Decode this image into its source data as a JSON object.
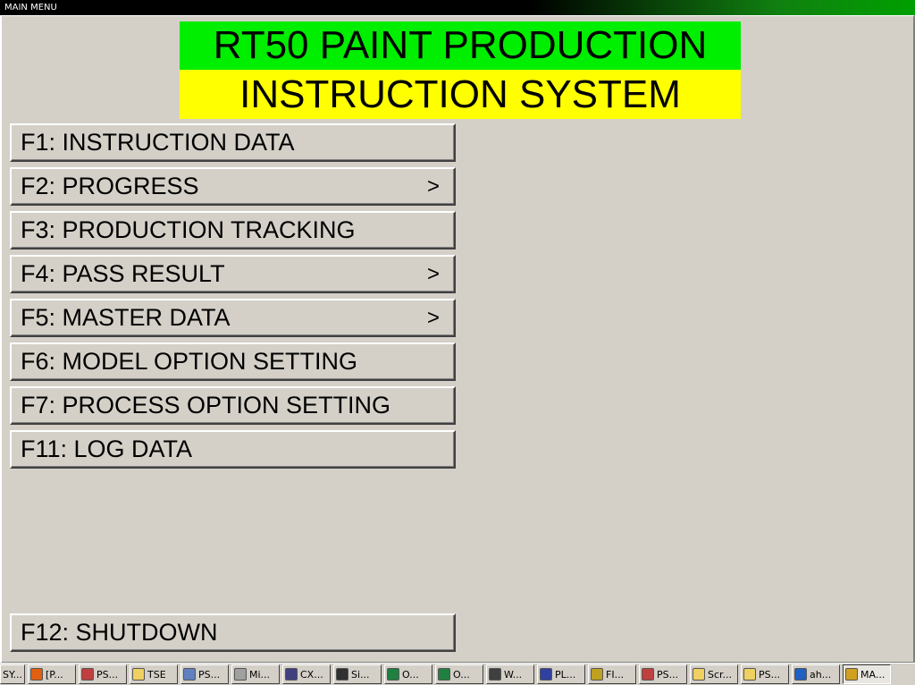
{
  "window": {
    "title": "MAIN MENU"
  },
  "banner": {
    "line1": "RT50 PAINT PRODUCTION",
    "line2": "INSTRUCTION SYSTEM"
  },
  "menu": [
    {
      "label": "F1: INSTRUCTION DATA",
      "arrow": ""
    },
    {
      "label": "F2: PROGRESS",
      "arrow": ">"
    },
    {
      "label": "F3: PRODUCTION TRACKING",
      "arrow": ""
    },
    {
      "label": "F4: PASS RESULT",
      "arrow": ">"
    },
    {
      "label": "F5: MASTER DATA",
      "arrow": ">"
    },
    {
      "label": "F6: MODEL OPTION SETTING",
      "arrow": ""
    },
    {
      "label": "F7: PROCESS OPTION SETTING",
      "arrow": ""
    },
    {
      "label": "F11: LOG DATA",
      "arrow": ""
    }
  ],
  "shutdown": {
    "label": "F12: SHUTDOWN"
  },
  "taskbar": [
    {
      "label": "SY...",
      "icon": "app-icon",
      "color": "#d4d0c8"
    },
    {
      "label": "[P...",
      "icon": "firefox-icon",
      "color": "#e06010"
    },
    {
      "label": "PS...",
      "icon": "ps-icon",
      "color": "#c04040"
    },
    {
      "label": "TSE",
      "icon": "folder-icon",
      "color": "#f0d060"
    },
    {
      "label": "PS...",
      "icon": "document-icon",
      "color": "#6080c0"
    },
    {
      "label": "Mi...",
      "icon": "tools-icon",
      "color": "#a0a0a0"
    },
    {
      "label": "CX...",
      "icon": "monitor-icon",
      "color": "#404080"
    },
    {
      "label": "Si...",
      "icon": "terminal-icon",
      "color": "#303030"
    },
    {
      "label": "O...",
      "icon": "excel-icon",
      "color": "#208040"
    },
    {
      "label": "O...",
      "icon": "excel-icon",
      "color": "#208040"
    },
    {
      "label": "W...",
      "icon": "window-icon",
      "color": "#404040"
    },
    {
      "label": "PL...",
      "icon": "grid-icon",
      "color": "#3040a0"
    },
    {
      "label": "FI...",
      "icon": "flag-icon",
      "color": "#c0a020"
    },
    {
      "label": "PS...",
      "icon": "ps-icon",
      "color": "#c04040"
    },
    {
      "label": "Scr...",
      "icon": "folder-icon",
      "color": "#f0d060"
    },
    {
      "label": "PS...",
      "icon": "folder-icon",
      "color": "#f0d060"
    },
    {
      "label": "ah...",
      "icon": "network-icon",
      "color": "#2060c0"
    },
    {
      "label": "MA...",
      "icon": "app-icon",
      "color": "#d0a020",
      "active": true
    }
  ]
}
